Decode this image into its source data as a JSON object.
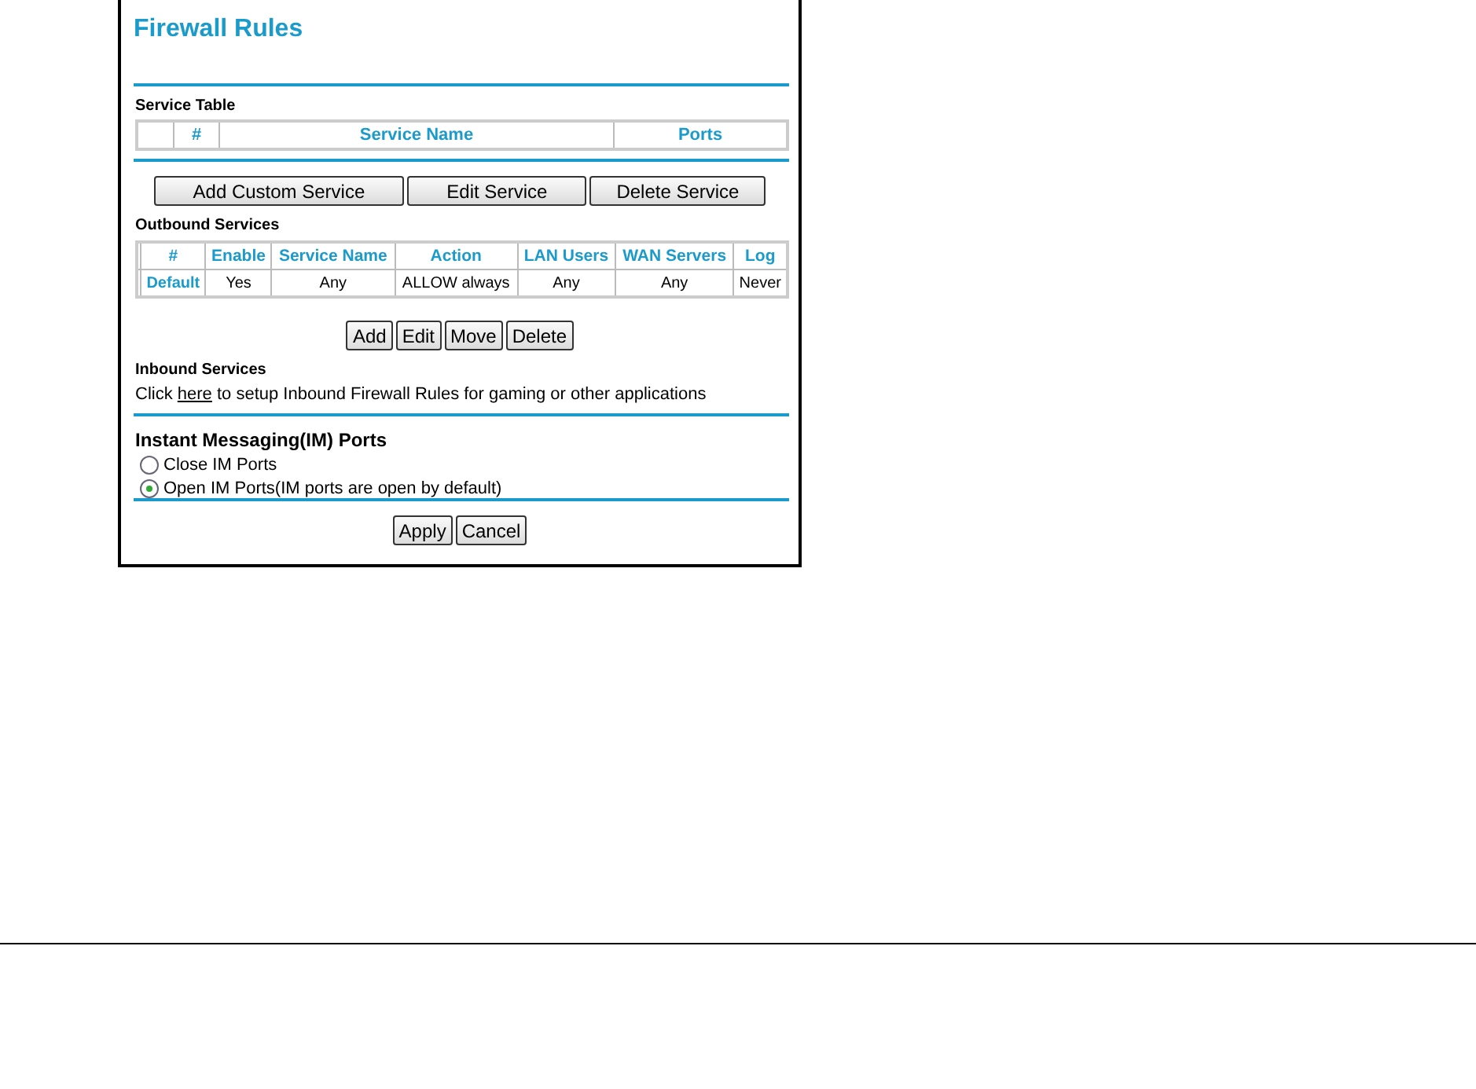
{
  "title": "Firewall Rules",
  "service_table": {
    "label": "Service Table",
    "columns": [
      "",
      "#",
      "Service Name",
      "Ports"
    ]
  },
  "service_buttons": [
    "Add Custom Service",
    "Edit Service",
    "Delete Service"
  ],
  "outbound": {
    "label": "Outbound Services",
    "columns": [
      "",
      "#",
      "Enable",
      "Service Name",
      "Action",
      "LAN Users",
      "WAN Servers",
      "Log"
    ],
    "rows": [
      {
        "cells": [
          "",
          "Default",
          "Yes",
          "Any",
          "ALLOW always",
          "Any",
          "Any",
          "Never"
        ]
      }
    ]
  },
  "outbound_buttons": [
    "Add",
    "Edit",
    "Move",
    "Delete"
  ],
  "inbound": {
    "label": "Inbound Services",
    "before": "Click ",
    "link": "here",
    "after": " to setup Inbound Firewall Rules for gaming or other applications"
  },
  "im_ports": {
    "label": "Instant Messaging(IM) Ports",
    "options": [
      {
        "label": "Close IM Ports",
        "selected": false
      },
      {
        "label": "Open IM Ports(IM ports are open by default)",
        "selected": true
      }
    ]
  },
  "footer_buttons": [
    "Apply",
    "Cancel"
  ]
}
